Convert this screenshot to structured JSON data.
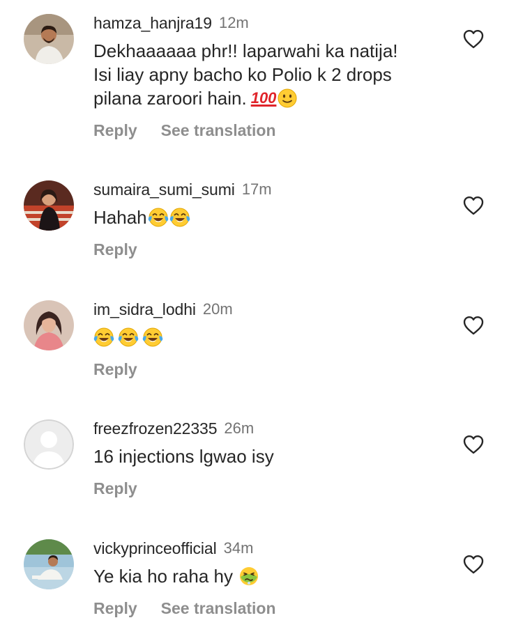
{
  "comments": [
    {
      "username": "hamza_hanjra19",
      "time": "12m",
      "text_lines": [
        "Dekhaaaaaa phr!! laparwahi ka natija!",
        "Isi liay apny bacho ko Polio k 2 drops",
        "pilana zaroori hain."
      ],
      "emojis": [
        "hundred-points-emoji",
        "slightly-smiling-face-emoji"
      ],
      "emoji_text": "100",
      "reply_label": "Reply",
      "translation_label": "See translation"
    },
    {
      "username": "sumaira_sumi_sumi",
      "time": "17m",
      "text": "Hahah",
      "emojis": [
        "face-with-tears-of-joy-emoji",
        "face-with-tears-of-joy-emoji"
      ],
      "reply_label": "Reply"
    },
    {
      "username": "im_sidra_lodhi",
      "time": "20m",
      "text": "",
      "emojis": [
        "face-with-tears-of-joy-emoji",
        "face-with-tears-of-joy-emoji",
        "face-with-tears-of-joy-emoji"
      ],
      "reply_label": "Reply"
    },
    {
      "username": "freezfrozen22335",
      "time": "26m",
      "text": "16 injections lgwao isy",
      "emojis": [],
      "reply_label": "Reply"
    },
    {
      "username": "vickyprinceofficial",
      "time": "34m",
      "text": "Ye kia ho raha hy",
      "emojis": [
        "nauseated-face-emoji"
      ],
      "reply_label": "Reply",
      "translation_label": "See translation"
    }
  ],
  "icons": {
    "like": "heart-outline-icon",
    "default_avatar": "default-avatar-icon"
  },
  "colors": {
    "text": "#262626",
    "secondary": "#8e8e8e",
    "timestamp": "#737373",
    "emoji_yellow": "#ffcc33",
    "emoji_red": "#e0242a",
    "nauseated_green": "#8cc63f"
  }
}
